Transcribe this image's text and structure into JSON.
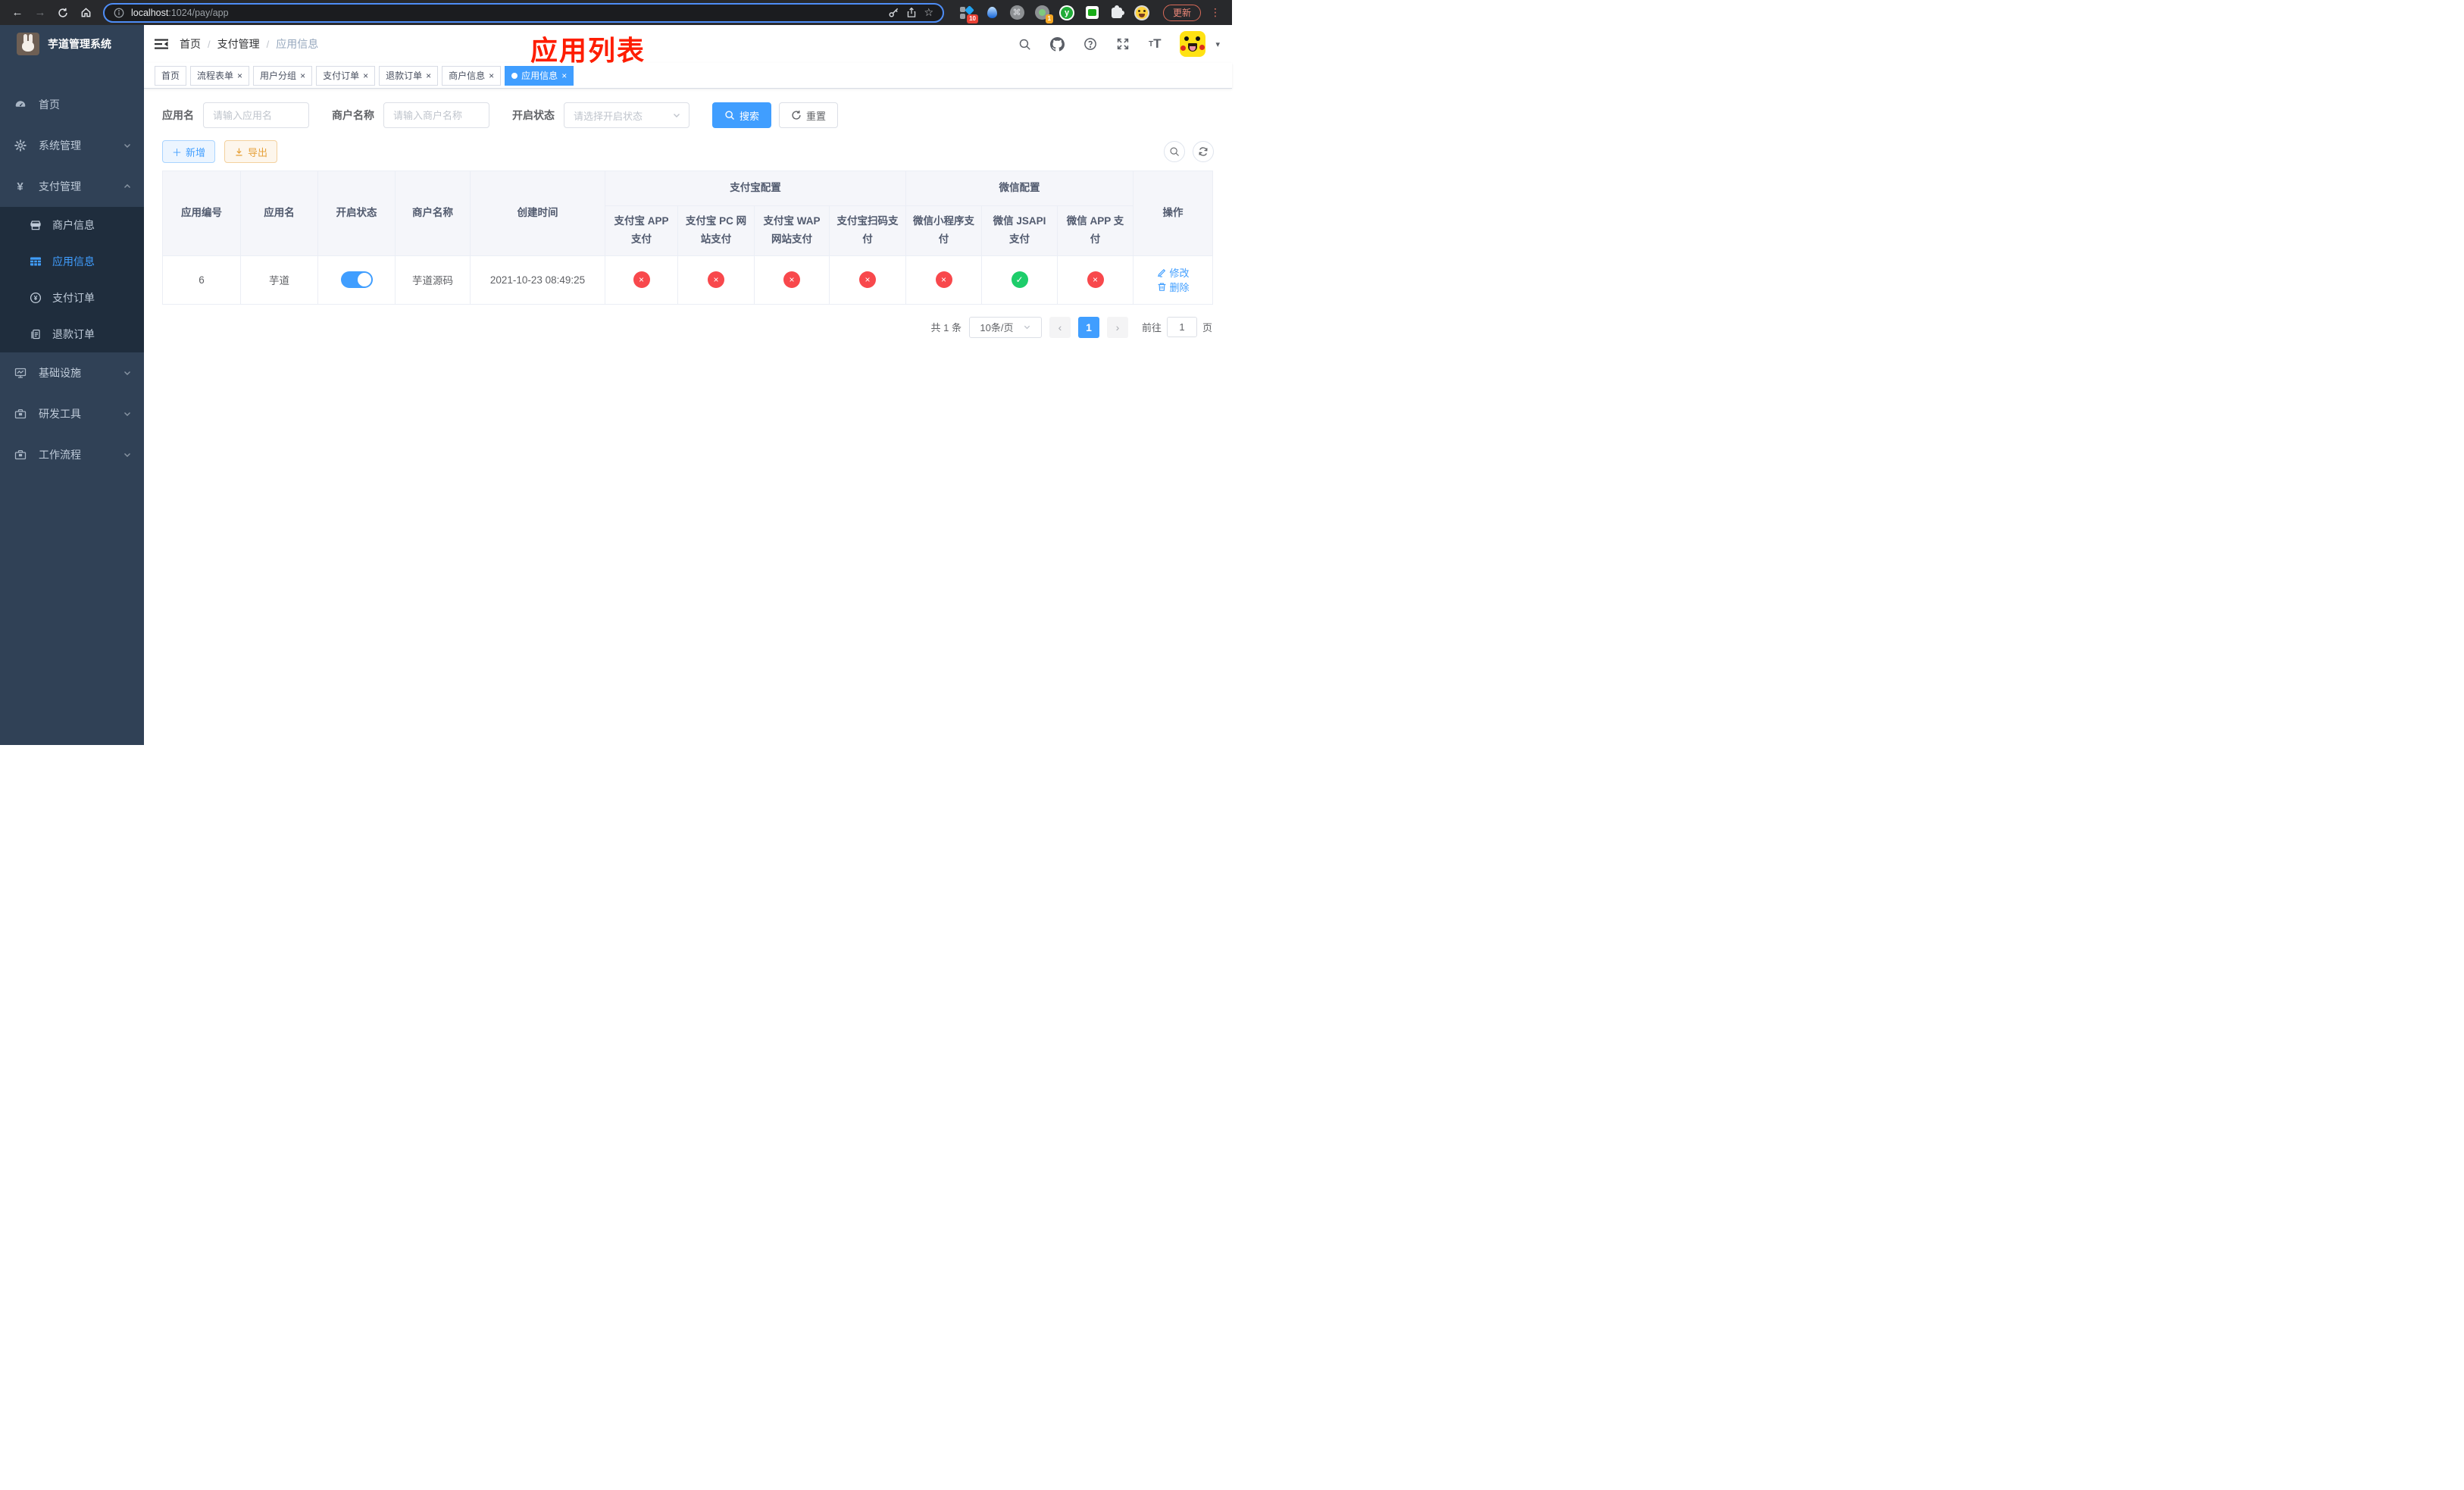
{
  "browser": {
    "url_host": "localhost",
    "url_path": ":1024/pay/app",
    "update_button": "更新",
    "ext_badges": {
      "first": "10",
      "second": "1"
    }
  },
  "sidebar": {
    "title": "芋道管理系统",
    "items": [
      {
        "label": "首页"
      },
      {
        "label": "系统管理"
      },
      {
        "label": "支付管理",
        "children": [
          {
            "label": "商户信息"
          },
          {
            "label": "应用信息"
          },
          {
            "label": "支付订单"
          },
          {
            "label": "退款订单"
          }
        ]
      },
      {
        "label": "基础设施"
      },
      {
        "label": "研发工具"
      },
      {
        "label": "工作流程"
      }
    ]
  },
  "header": {
    "breadcrumb": [
      "首页",
      "支付管理",
      "应用信息"
    ]
  },
  "annotation": "应用列表",
  "tabs": [
    {
      "label": "首页"
    },
    {
      "label": "流程表单"
    },
    {
      "label": "用户分组"
    },
    {
      "label": "支付订单"
    },
    {
      "label": "退款订单"
    },
    {
      "label": "商户信息"
    },
    {
      "label": "应用信息"
    }
  ],
  "filters": {
    "app_name": {
      "label": "应用名",
      "placeholder": "请输入应用名"
    },
    "merchant": {
      "label": "商户名称",
      "placeholder": "请输入商户名称"
    },
    "status": {
      "label": "开启状态",
      "placeholder": "请选择开启状态"
    },
    "search_button": "搜索",
    "reset_button": "重置"
  },
  "toolbar": {
    "add_button": "新增",
    "export_button": "导出"
  },
  "table": {
    "columns": {
      "app_id": "应用编号",
      "app_name": "应用名",
      "status": "开启状态",
      "merchant": "商户名称",
      "created": "创建时间",
      "alipay_group": "支付宝配置",
      "wechat_group": "微信配置",
      "alipay_app": "支付宝 APP 支付",
      "alipay_pc": "支付宝 PC 网站支付",
      "alipay_wap": "支付宝 WAP 网站支付",
      "alipay_qr": "支付宝扫码支付",
      "wx_lite": "微信小程序支付",
      "wx_jsapi": "微信 JSAPI 支付",
      "wx_app": "微信 APP 支付",
      "actions": "操作"
    },
    "row": {
      "app_id": "6",
      "app_name": "芋道",
      "enabled": true,
      "merchant": "芋道源码",
      "created": "2021-10-23 08:49:25",
      "pay_status": [
        false,
        false,
        false,
        false,
        false,
        true,
        false
      ],
      "edit_label": "修改",
      "delete_label": "删除"
    }
  },
  "pagination": {
    "total": "共 1 条",
    "page_size": "10条/页",
    "current_page": "1",
    "goto_label": "前往",
    "goto_value": "1",
    "goto_suffix": "页"
  },
  "colors": {
    "primary": "#409eff",
    "success_badge": "#1dcd6a",
    "fail_badge": "#f8484c",
    "sidebar_bg": "#304156",
    "submenu_bg": "#1f2d3d",
    "annotation": "#fe1d00"
  }
}
